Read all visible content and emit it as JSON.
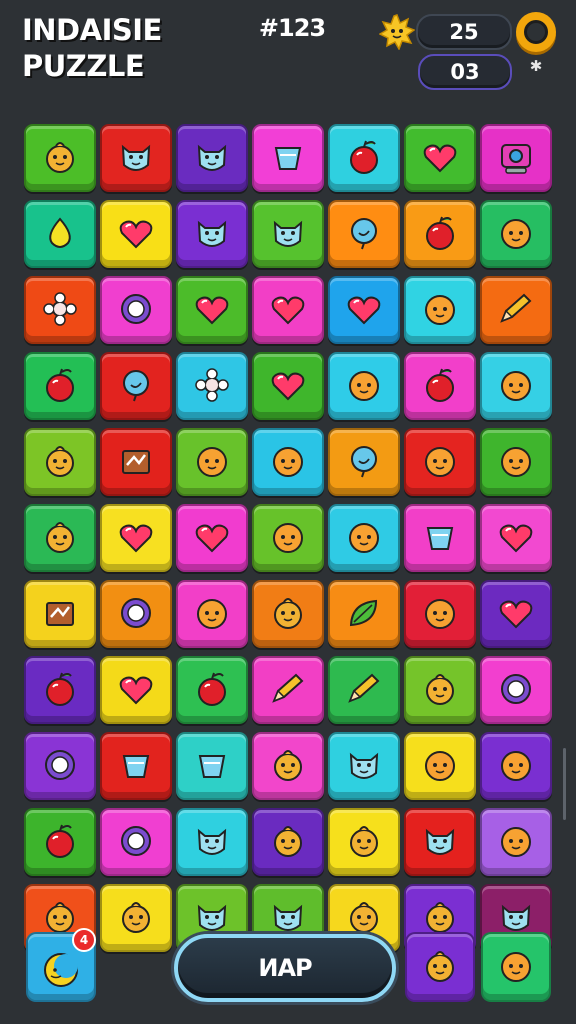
{
  "header": {
    "title_line1": "INDAISIE",
    "title_line2": "PUZZLE",
    "level": "#123",
    "score": "25",
    "moves": "03",
    "close_symbol": "✱"
  },
  "board": {
    "rows": [
      [
        {
          "color": "#4cbe28",
          "icon": "chick"
        },
        {
          "color": "#e22520",
          "icon": "cat"
        },
        {
          "color": "#6a2cc0",
          "icon": "cat"
        },
        {
          "color": "#f23fd6",
          "icon": "cup"
        },
        {
          "color": "#2fd0e0",
          "icon": "apple"
        },
        {
          "color": "#42bc2e",
          "icon": "heart"
        },
        {
          "color": "#e631c7",
          "icon": "robot"
        }
      ],
      [
        {
          "color": "#18c28c",
          "icon": "drop"
        },
        {
          "color": "#f8df17",
          "icon": "heart"
        },
        {
          "color": "#7a2fd2",
          "icon": "cat"
        },
        {
          "color": "#56c22e",
          "icon": "cat"
        },
        {
          "color": "#ff8d12",
          "icon": "balloon"
        },
        {
          "color": "#f99b15",
          "icon": "apple"
        },
        {
          "color": "#26be62",
          "icon": "face"
        }
      ],
      [
        {
          "color": "#ef4a15",
          "icon": "flower"
        },
        {
          "color": "#f03fcf",
          "icon": "bubble"
        },
        {
          "color": "#4cbc2a",
          "icon": "heart"
        },
        {
          "color": "#f23fc6",
          "icon": "heart"
        },
        {
          "color": "#1fa4ec",
          "icon": "heart"
        },
        {
          "color": "#30d3e3",
          "icon": "face"
        },
        {
          "color": "#f46b12",
          "icon": "pencil"
        }
      ],
      [
        {
          "color": "#23bf55",
          "icon": "apple"
        },
        {
          "color": "#e2231f",
          "icon": "balloon"
        },
        {
          "color": "#2fc6e5",
          "icon": "flower"
        },
        {
          "color": "#3fb62c",
          "icon": "heart"
        },
        {
          "color": "#2fcce8",
          "icon": "face"
        },
        {
          "color": "#f23fca",
          "icon": "apple"
        },
        {
          "color": "#35d0e5",
          "icon": "face"
        }
      ],
      [
        {
          "color": "#7dc526",
          "icon": "chick"
        },
        {
          "color": "#e2221c",
          "icon": "box"
        },
        {
          "color": "#68c22b",
          "icon": "face"
        },
        {
          "color": "#2ac4e6",
          "icon": "face"
        },
        {
          "color": "#f39b13",
          "icon": "balloon"
        },
        {
          "color": "#e42420",
          "icon": "face"
        },
        {
          "color": "#3fb52d",
          "icon": "face"
        }
      ],
      [
        {
          "color": "#2bb955",
          "icon": "chick"
        },
        {
          "color": "#f7e021",
          "icon": "heart"
        },
        {
          "color": "#f13ccf",
          "icon": "heart"
        },
        {
          "color": "#67c22a",
          "icon": "face"
        },
        {
          "color": "#2fcbe5",
          "icon": "face"
        },
        {
          "color": "#f23fc8",
          "icon": "cup"
        },
        {
          "color": "#f249d0",
          "icon": "heart"
        }
      ],
      [
        {
          "color": "#f4d21d",
          "icon": "box"
        },
        {
          "color": "#f28f12",
          "icon": "bubble"
        },
        {
          "color": "#f23fc8",
          "icon": "face"
        },
        {
          "color": "#f17d15",
          "icon": "chick"
        },
        {
          "color": "#f78c14",
          "icon": "leaf"
        },
        {
          "color": "#e21f37",
          "icon": "face"
        },
        {
          "color": "#6c2ac0",
          "icon": "heart"
        }
      ],
      [
        {
          "color": "#6a2bc2",
          "icon": "apple"
        },
        {
          "color": "#f4da19",
          "icon": "heart"
        },
        {
          "color": "#2ec052",
          "icon": "apple"
        },
        {
          "color": "#f23fc5",
          "icon": "pencil"
        },
        {
          "color": "#2eba4f",
          "icon": "pencil"
        },
        {
          "color": "#75c42a",
          "icon": "chick"
        },
        {
          "color": "#f23fcf",
          "icon": "bubble"
        }
      ],
      [
        {
          "color": "#8a34d5",
          "icon": "bubble"
        },
        {
          "color": "#e2231e",
          "icon": "cup"
        },
        {
          "color": "#2ed0c7",
          "icon": "cup"
        },
        {
          "color": "#f246cb",
          "icon": "chick"
        },
        {
          "color": "#2fd0e0",
          "icon": "cat"
        },
        {
          "color": "#f6df1c",
          "icon": "face"
        },
        {
          "color": "#7a2fd1",
          "icon": "face"
        }
      ],
      [
        {
          "color": "#3db42c",
          "icon": "apple"
        },
        {
          "color": "#f03fd1",
          "icon": "bubble"
        },
        {
          "color": "#2fd0e0",
          "icon": "cat"
        },
        {
          "color": "#6a2bc0",
          "icon": "chick"
        },
        {
          "color": "#f6e01c",
          "icon": "chick"
        },
        {
          "color": "#e4211e",
          "icon": "cat"
        },
        {
          "color": "#a760e6",
          "icon": "face"
        }
      ],
      [
        {
          "color": "#f0501a",
          "icon": "chick"
        },
        {
          "color": "#f6de1c",
          "icon": "chick"
        },
        {
          "color": "#6dc22a",
          "icon": "cat"
        },
        {
          "color": "#5fbd2c",
          "icon": "cat"
        },
        {
          "color": "#f6d81d",
          "icon": "chick"
        },
        {
          "color": "#7b2fd2",
          "icon": "chick"
        },
        {
          "color": "#8c1f68",
          "icon": "cat"
        }
      ]
    ]
  },
  "footer": {
    "boost_count": "4",
    "map_label": "ИAP",
    "left_tile_color": "#7a2fd2",
    "right_tile_color": "#25c46a"
  }
}
